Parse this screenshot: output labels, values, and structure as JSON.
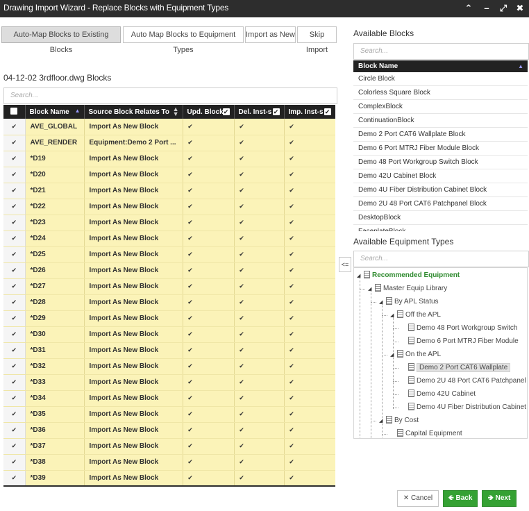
{
  "window": {
    "title": "Drawing Import Wizard - Replace Blocks with Equipment Types",
    "controls": [
      "collapse-up",
      "minimize",
      "maximize",
      "close"
    ]
  },
  "toolbar": {
    "auto_map_existing": "Auto-Map Blocks to Existing Blocks",
    "auto_map_equipment": "Auto Map Blocks to Equipment Types",
    "import_as_new": "Import as New",
    "skip_import": "Skip Import"
  },
  "blocks_panel": {
    "title": "04-12-02 3rdfloor.dwg Blocks",
    "search_placeholder": "Search...",
    "columns": [
      "Block Name",
      "Source Block Relates To",
      "Upd. Block",
      "Del. Inst-s",
      "Imp. Inst-s"
    ],
    "rows": [
      {
        "name": "AVE_GLOBAL",
        "relates": "Import As New Block"
      },
      {
        "name": "AVE_RENDER",
        "relates": "Equipment:Demo 2 Port ..."
      },
      {
        "name": "*D19",
        "relates": "Import As New Block"
      },
      {
        "name": "*D20",
        "relates": "Import As New Block"
      },
      {
        "name": "*D21",
        "relates": "Import As New Block"
      },
      {
        "name": "*D22",
        "relates": "Import As New Block"
      },
      {
        "name": "*D23",
        "relates": "Import As New Block"
      },
      {
        "name": "*D24",
        "relates": "Import As New Block"
      },
      {
        "name": "*D25",
        "relates": "Import As New Block"
      },
      {
        "name": "*D26",
        "relates": "Import As New Block"
      },
      {
        "name": "*D27",
        "relates": "Import As New Block"
      },
      {
        "name": "*D28",
        "relates": "Import As New Block"
      },
      {
        "name": "*D29",
        "relates": "Import As New Block"
      },
      {
        "name": "*D30",
        "relates": "Import As New Block"
      },
      {
        "name": "*D31",
        "relates": "Import As New Block"
      },
      {
        "name": "*D32",
        "relates": "Import As New Block"
      },
      {
        "name": "*D33",
        "relates": "Import As New Block"
      },
      {
        "name": "*D34",
        "relates": "Import As New Block"
      },
      {
        "name": "*D35",
        "relates": "Import As New Block"
      },
      {
        "name": "*D36",
        "relates": "Import As New Block"
      },
      {
        "name": "*D37",
        "relates": "Import As New Block"
      },
      {
        "name": "*D38",
        "relates": "Import As New Block"
      },
      {
        "name": "*D39",
        "relates": "Import As New Block"
      }
    ]
  },
  "available_blocks": {
    "title": "Available Blocks",
    "search_placeholder": "Search...",
    "column": "Block Name",
    "items": [
      "Circle Block",
      "Colorless Square Block",
      "ComplexBlock",
      "ContinuationBlock",
      "Demo 2 Port CAT6 Wallplate Block",
      "Demo 6 Port MTRJ Fiber Module Block",
      "Demo 48 Port Workgroup Switch Block",
      "Demo 42U Cabinet Block",
      "Demo 4U Fiber Distribution Cabinet Block",
      "Demo 2U 48 Port CAT6 Patchpanel Block",
      "DesktopBlock",
      "FaceplateBlock"
    ]
  },
  "move_button": "<=",
  "equipment_types": {
    "title": "Available Equipment Types",
    "search_placeholder": "Search...",
    "tree": [
      {
        "label": "Recommended Equipment"
      },
      {
        "label": "Master Equip Library"
      },
      {
        "label": "By APL Status"
      },
      {
        "label": "Off the APL"
      },
      {
        "label": "Demo 48 Port Workgroup Switch"
      },
      {
        "label": "Demo 6 Port MTRJ Fiber Module"
      },
      {
        "label": "On the APL"
      },
      {
        "label": "Demo 2 Port CAT6 Wallplate"
      },
      {
        "label": "Demo 2U 48 Port CAT6 Patchpanel"
      },
      {
        "label": "Demo 42U Cabinet"
      },
      {
        "label": "Demo 4U Fiber Distribution Cabinet"
      },
      {
        "label": "By Cost"
      },
      {
        "label": "Capital Equipment"
      }
    ]
  },
  "footer": {
    "cancel": "Cancel",
    "back": "Back",
    "next": "Next"
  },
  "colors": {
    "titlebar": "#2d2d2d",
    "row_highlight": "#fbf3b8",
    "primary_green": "#35a133",
    "recommended_green": "#2e8a2e"
  }
}
